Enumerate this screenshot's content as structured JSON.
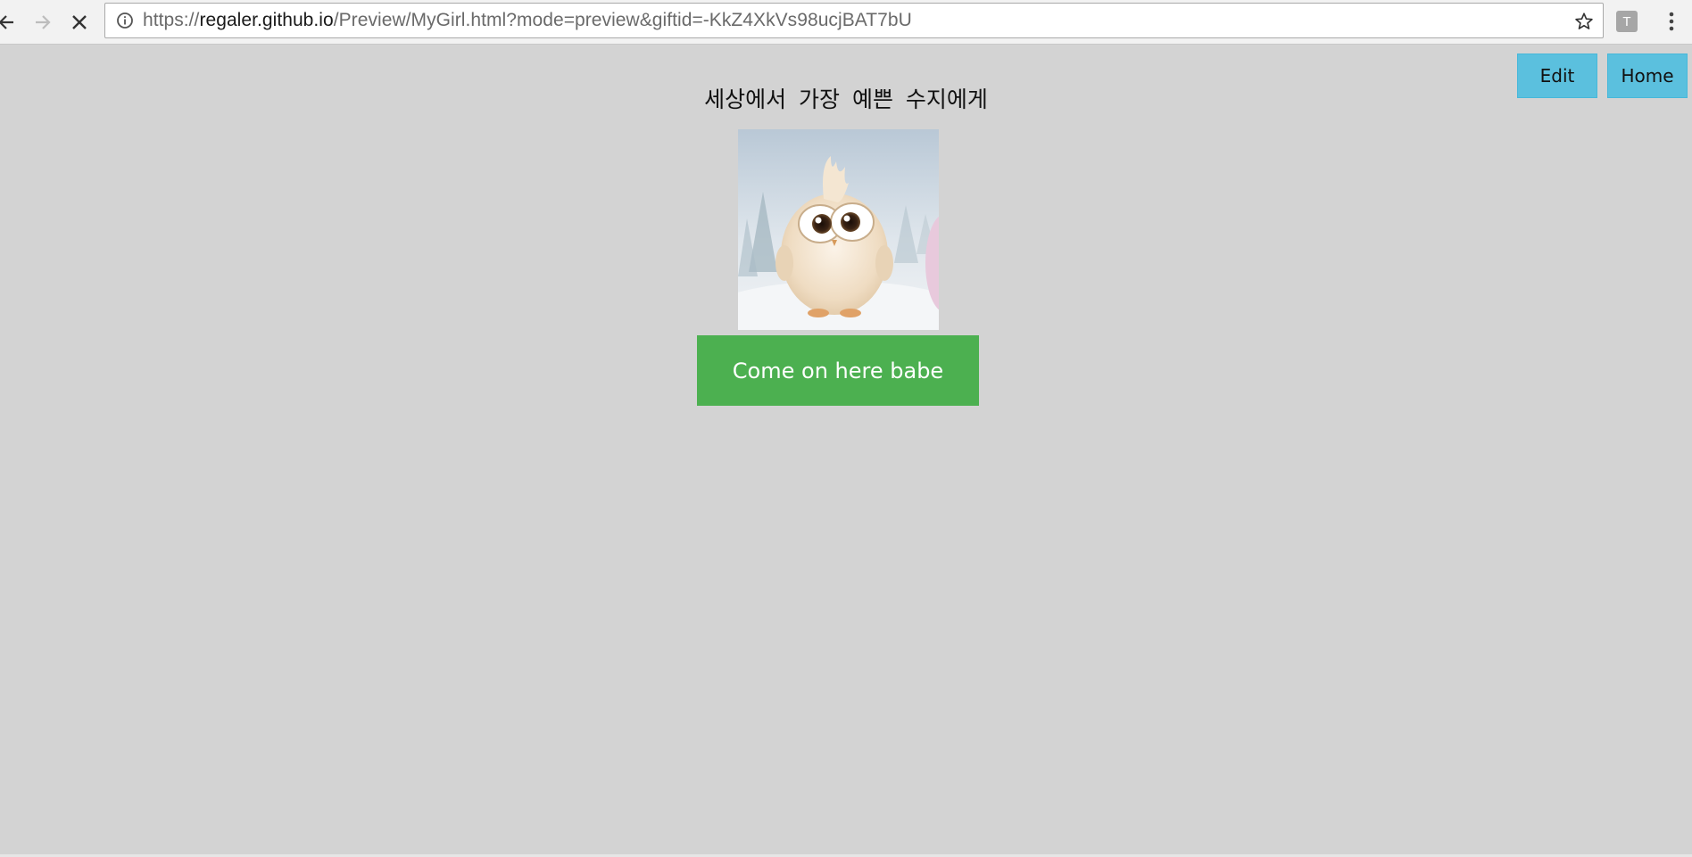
{
  "browser": {
    "url_scheme": "https://",
    "url_host": "regaler.github.io",
    "url_path": "/Preview/MyGirl.html?mode=preview&giftid=-KkZ4XkVs98ucjBAT7bU",
    "extension_label": "T",
    "icons": {
      "back": "arrow-left-icon",
      "forward": "arrow-right-icon",
      "stop": "close-icon",
      "info": "info-icon",
      "bookmark": "star-icon",
      "menu": "vertical-dots-icon"
    }
  },
  "page": {
    "background_color": "#d3d3d3",
    "header_buttons": {
      "edit_label": "Edit",
      "home_label": "Home",
      "color": "#5bc0de"
    },
    "title": "세상에서 가장 예쁜 수지에게",
    "image": {
      "subject": "fluffy white cartoon chick standing in snow"
    },
    "cta": {
      "label": "Come on here babe",
      "color": "#4cb050"
    }
  }
}
